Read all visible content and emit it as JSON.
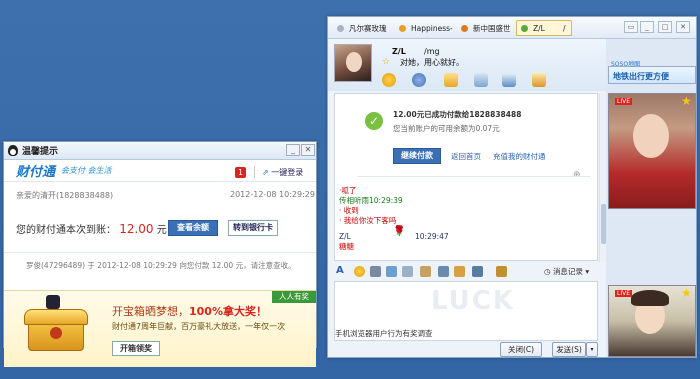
{
  "left_popup": {
    "title": "温馨提示",
    "brand_name": "财付通",
    "slogan": "会支付 会生活",
    "badge_count": "1",
    "login_link": "一键登录",
    "account_line": "亲爱的清开(1828838488)",
    "account_time": "2012-12-08 10:29:29",
    "notice_prefix": "您的财付通本次到账：",
    "notice_amount": "12.00",
    "notice_unit": "元",
    "check_balance_button": "查看余额",
    "transfer_bank_button": "转到银行卡",
    "payer_line": "罗俊(47296489) 于 2012-12-08 10:29:29 向您付款 12.00 元，请注意查收。",
    "promo_tag": "人人有奖",
    "promo_headline": "开宝箱晒梦想，",
    "promo_highlight": "100%拿大奖！",
    "promo_sub": "财付通7周年巨献，百万豪礼大放送，一年仅一次",
    "promo_button": "开箱领奖",
    "colors": {
      "brand": "#1a78c8",
      "amount": "#d9261c",
      "button": "#3a70b5"
    }
  },
  "chat_window": {
    "tabs": [
      {
        "label": "凡尔赛玫瑰",
        "dot": "#a8b4c4"
      },
      {
        "label": "Happiness-",
        "dot": "#e8a020"
      },
      {
        "label": "新中国盛世",
        "dot": "#e07a20"
      },
      {
        "label": "Z/L",
        "dot": "#5aa83a"
      }
    ],
    "tab_extra": "/",
    "window_icons": [
      "skin-icon",
      "minimize-icon",
      "maximize-icon",
      "close-icon"
    ],
    "contact": {
      "name": "Z/L",
      "status_emoticon": "/mg",
      "signature": "对她，用心就好。"
    },
    "pay_card": {
      "line1": "12.00元已成功付款给1828838488",
      "line2": "您当前账户的可用余额为0.07元",
      "continue_button": "继续付款",
      "return_link": "返回首页",
      "recharge_link": "充值我的财付通"
    },
    "messages": [
      {
        "text": "·呱了",
        "color": "red"
      },
      {
        "text": "传相听雨",
        "time": "10:29:39",
        "color": "green"
      },
      {
        "text": "· 收到",
        "color": "red"
      },
      {
        "text": "· 我给你汝下客吗",
        "color": "red"
      },
      {
        "text": "Z/L",
        "time": "10:29:47",
        "color": "dkblue"
      },
      {
        "text": "糖糖",
        "color": "red"
      }
    ],
    "history_button": "消息记录",
    "survey_text": "手机浏览器用户行为有奖调查",
    "close_button": "关闭(C)",
    "send_button": "发送(S)",
    "watermark_text": "LUCK",
    "sidebar_ad": {
      "brand": "SOSO地图",
      "text": "地铁出行更方便"
    },
    "photo_badges": [
      "LIVE",
      "LIVE"
    ]
  }
}
